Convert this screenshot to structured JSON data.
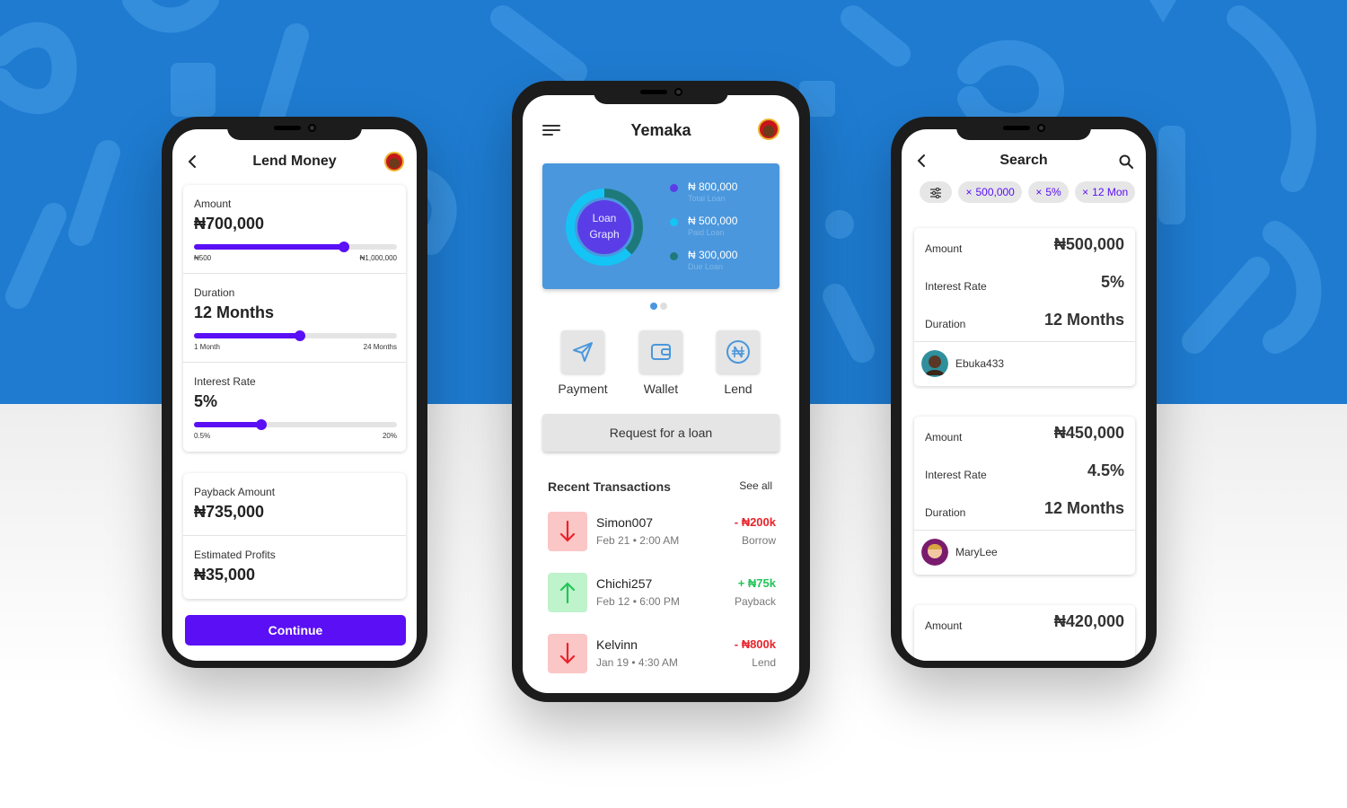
{
  "colors": {
    "background_blue": "#1e7bd0",
    "accent_purple": "#5a0ff5",
    "card_blue": "#4a97dd",
    "debit_red": "#e8232a",
    "credit_green": "#25c45a"
  },
  "lend_screen": {
    "title": "Lend Money",
    "amount": {
      "label": "Amount",
      "value": "₦700,000",
      "min": "₦500",
      "max": "₦1,000,000",
      "fraction": 0.74
    },
    "duration": {
      "label": "Duration",
      "value": "12 Months",
      "min": "1 Month",
      "max": "24 Months",
      "fraction": 0.52
    },
    "interest": {
      "label": "Interest Rate",
      "value": "5%",
      "min": "0.5%",
      "max": "20%",
      "fraction": 0.33
    },
    "payback": {
      "label": "Payback Amount",
      "value": "₦735,000"
    },
    "profits": {
      "label": "Estimated Profits",
      "value": "₦35,000"
    },
    "continue_label": "Continue"
  },
  "home_screen": {
    "title": "Yemaka",
    "graph": {
      "center_label_1": "Loan",
      "center_label_2": "Graph",
      "total": {
        "value": "₦ 800,000",
        "label": "Total Loan",
        "color": "#5b3de8"
      },
      "paid": {
        "value": "₦ 500,000",
        "label": "Paid Loan",
        "color": "#14c4f5",
        "amount": 500000
      },
      "due": {
        "value": "₦ 300,000",
        "label": "Due Loan",
        "color": "#1e7a7a",
        "amount": 300000
      }
    },
    "pager": {
      "count": 2,
      "active": 0
    },
    "actions": [
      {
        "label": "Payment",
        "icon": "send-icon"
      },
      {
        "label": "Wallet",
        "icon": "wallet-icon"
      },
      {
        "label": "Lend",
        "icon": "naira-coin-icon"
      }
    ],
    "request_label": "Request for a loan",
    "recent_title": "Recent Transactions",
    "see_all": "See all",
    "transactions": [
      {
        "name": "Simon007",
        "date": "Feb 21 • 2:00 AM",
        "amount": "- ₦200k",
        "kind": "Borrow",
        "direction": "down"
      },
      {
        "name": "Chichi257",
        "date": "Feb 12 • 6:00 PM",
        "amount": "+ ₦75k",
        "kind": "Payback",
        "direction": "up"
      },
      {
        "name": "Kelvinn",
        "date": "Jan 19 • 4:30 AM",
        "amount": "- ₦800k",
        "kind": "Lend",
        "direction": "down"
      }
    ]
  },
  "search_screen": {
    "title": "Search",
    "chips": [
      "500,000",
      "5%",
      "12 Mon"
    ],
    "results": [
      {
        "amount_label": "Amount",
        "amount": "₦500,000",
        "rate_label": "Interest Rate",
        "rate": "5%",
        "duration_label": "Duration",
        "duration": "12 Months",
        "user": "Ebuka433"
      },
      {
        "amount_label": "Amount",
        "amount": "₦450,000",
        "rate_label": "Interest Rate",
        "rate": "4.5%",
        "duration_label": "Duration",
        "duration": "12 Months",
        "user": "MaryLee"
      },
      {
        "amount_label": "Amount",
        "amount": "₦420,000"
      }
    ]
  }
}
